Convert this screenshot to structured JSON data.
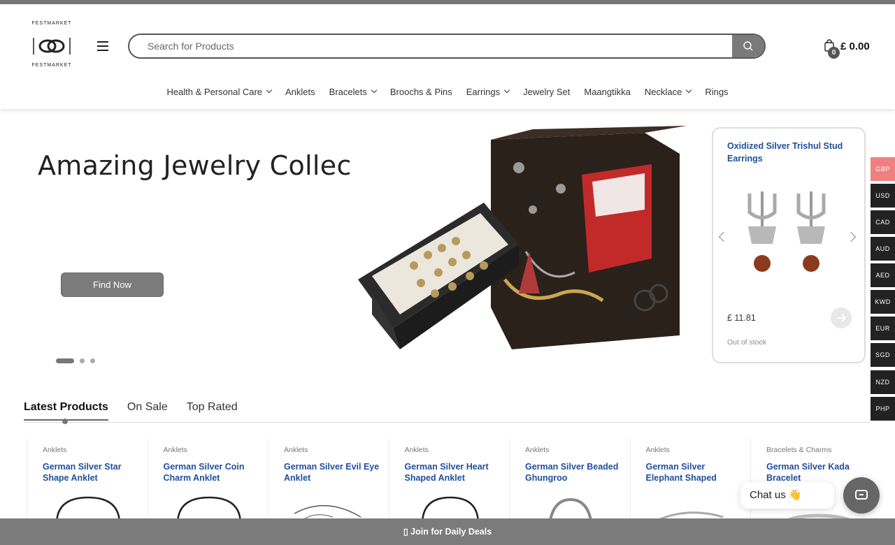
{
  "brand": {
    "logo_top": "FESTMARKET",
    "logo_bottom": "FESTMARKET"
  },
  "search": {
    "placeholder": "Search for Products"
  },
  "cart": {
    "count": "0",
    "total": "£ 0.00"
  },
  "nav": [
    {
      "label": "Health & Personal Care",
      "dropdown": true
    },
    {
      "label": "Anklets",
      "dropdown": false
    },
    {
      "label": "Bracelets",
      "dropdown": true
    },
    {
      "label": "Broochs & Pins",
      "dropdown": false
    },
    {
      "label": "Earrings",
      "dropdown": true
    },
    {
      "label": "Jewelry Set",
      "dropdown": false
    },
    {
      "label": "Maangtikka",
      "dropdown": false
    },
    {
      "label": "Necklace",
      "dropdown": true
    },
    {
      "label": "Rings",
      "dropdown": false
    }
  ],
  "hero": {
    "title": "Amazing Jewelry Collection",
    "button": "Find Now"
  },
  "featured": {
    "title": "Oxidized Silver Trishul Stud Earrings",
    "price": "£ 11.81",
    "stock": "Out of stock"
  },
  "currencies": [
    "GBP",
    "USD",
    "CAD",
    "AUD",
    "AED",
    "KWD",
    "EUR",
    "SGD",
    "NZD",
    "PHP"
  ],
  "active_currency": "GBP",
  "tabs": [
    "Latest Products",
    "On Sale",
    "Top Rated"
  ],
  "products": [
    {
      "category": "Anklets",
      "name": "German Silver Star Shape Anklet"
    },
    {
      "category": "Anklets",
      "name": "German Silver Coin Charm Anklet"
    },
    {
      "category": "Anklets",
      "name": "German Silver Evil Eye Anklet"
    },
    {
      "category": "Anklets",
      "name": "German Silver Heart Shaped Anklet"
    },
    {
      "category": "Anklets",
      "name": "German Silver Beaded Ghungroo"
    },
    {
      "category": "Anklets",
      "name": "German Silver Elephant Shaped"
    },
    {
      "category": "Bracelets & Charms",
      "name": "German Silver Kada Bracelet"
    }
  ],
  "chat": {
    "label": "Chat us 👋"
  },
  "deals": {
    "label": "Join for Daily Deals"
  },
  "colors": {
    "accent_link": "#1f4e9d",
    "active_currency": "#f08080"
  }
}
